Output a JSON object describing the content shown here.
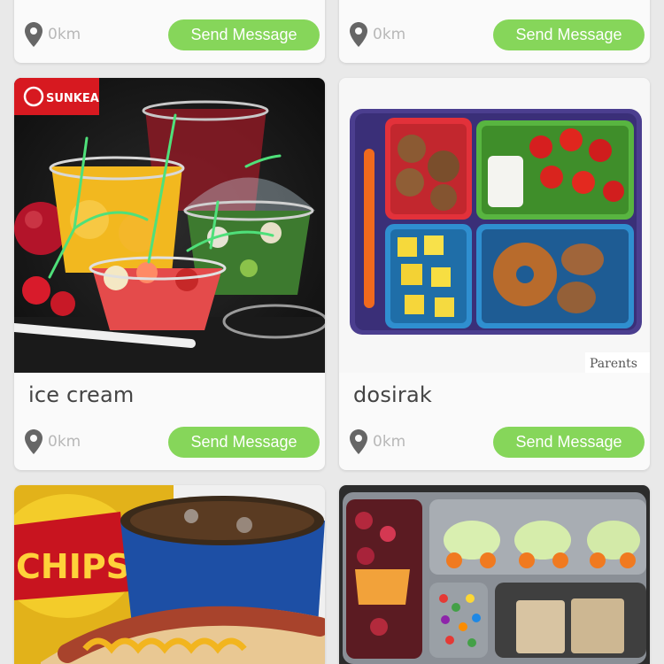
{
  "cards": [
    {
      "title": "",
      "distance": "0km",
      "action": "Send Message"
    },
    {
      "title": "",
      "distance": "0km",
      "action": "Send Message"
    },
    {
      "title": "ice cream",
      "distance": "0km",
      "action": "Send Message",
      "brand_badge": "SUNKEA"
    },
    {
      "title": "dosirak",
      "distance": "0km",
      "action": "Send Message",
      "watermark": "Parents"
    },
    {
      "title": "",
      "distance": "",
      "action": "",
      "image_text": "CHIPS"
    },
    {
      "title": "",
      "distance": "",
      "action": ""
    }
  ],
  "colors": {
    "accent": "#86d65a",
    "title_text": "#444444",
    "muted_text": "#b8b8b8",
    "background": "#e9e9e9"
  },
  "icons": [
    "location-pin-icon"
  ]
}
